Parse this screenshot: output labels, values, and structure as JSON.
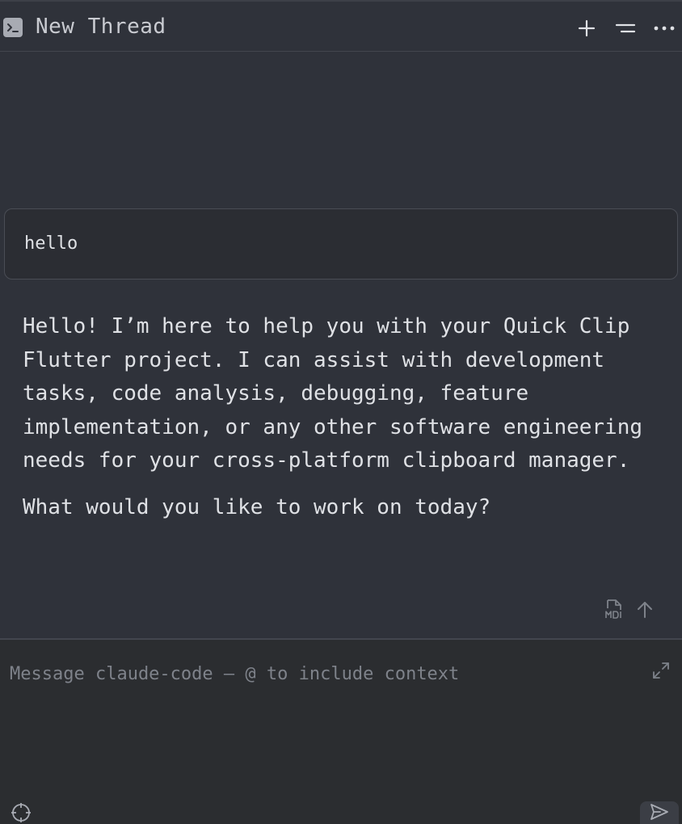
{
  "header": {
    "title": "New Thread",
    "icons": [
      "terminal-icon",
      "plus-icon",
      "history-icon",
      "more-icon"
    ]
  },
  "thread": {
    "user_message": "hello",
    "assistant_paragraphs": [
      "Hello! I’m here to help you with your Quick Clip Flutter project. I can assist with development tasks, code analysis, debugging, feature implementation, or any other software engineering needs for your cross-platform clipboard manager.",
      "What would you like to work on today?"
    ],
    "message_action_icons": [
      "markdown-file-icon",
      "scroll-up-icon"
    ]
  },
  "composer": {
    "placeholder": "Message claude-code — @ to include context",
    "value": "",
    "icons": [
      "expand-icon",
      "target-icon",
      "send-icon"
    ]
  },
  "colors": {
    "background": "#2f323a",
    "composer_background": "#2b2d30",
    "text": "#dfe1e5",
    "muted_text": "#7e828a",
    "border": "#43464e"
  }
}
